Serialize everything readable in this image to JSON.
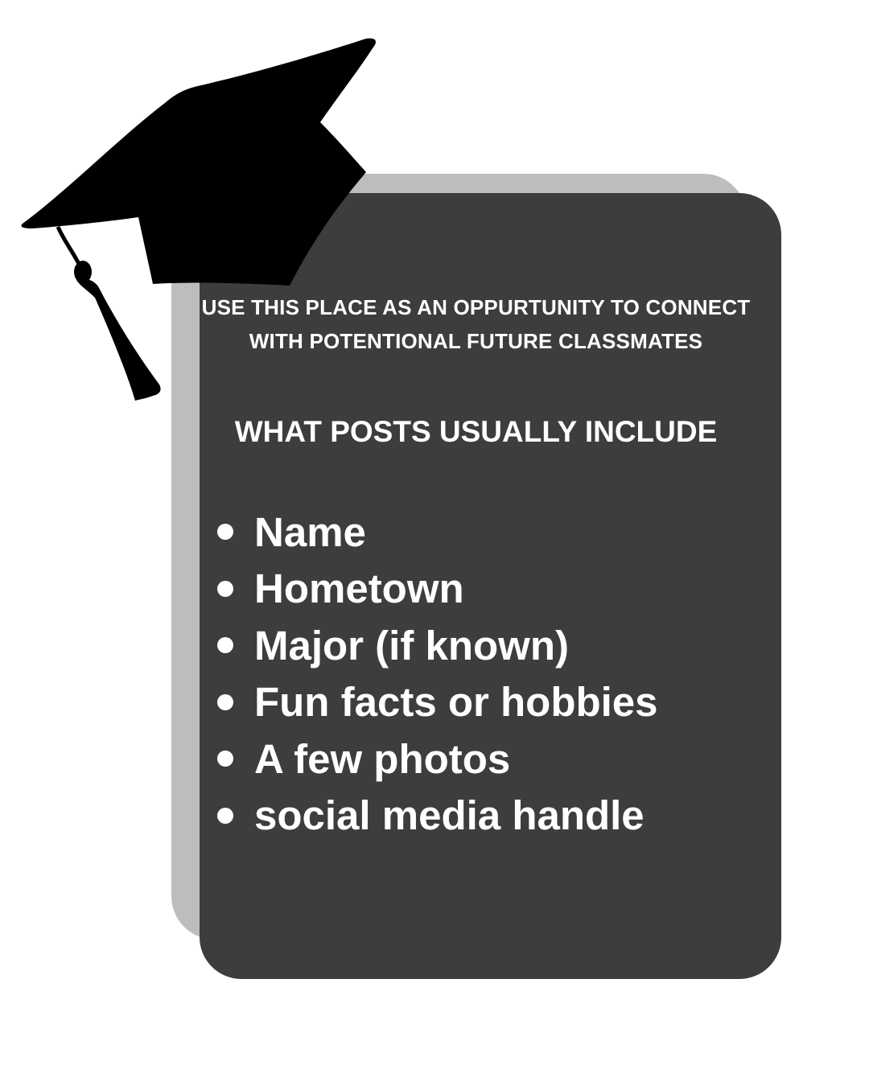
{
  "card": {
    "intro_text": "USE THIS PLACE AS AN OPPURTUNITY TO CONNECT WITH POTENTIONAL FUTURE CLASSMATES",
    "heading": "WHAT POSTS USUALLY INCLUDE",
    "items": [
      "Name",
      "Hometown",
      "Major (if known)",
      "Fun facts or hobbies",
      "A few photos",
      "social media handle"
    ]
  },
  "graphics": {
    "cap_icon": "graduation-cap-icon",
    "colors": {
      "background": "#ffffff",
      "card": "#3d3d3d",
      "card_shadow": "#bdbdbd",
      "text": "#ffffff",
      "cap": "#000000"
    }
  }
}
